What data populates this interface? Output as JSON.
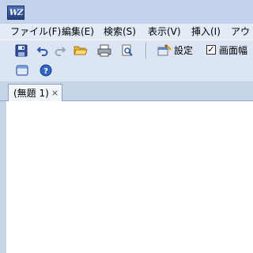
{
  "window": {
    "app_icon_text": "WZ"
  },
  "menubar": {
    "items": [
      {
        "label": "ファイル(F)"
      },
      {
        "label": "編集(E)"
      },
      {
        "label": "検索(S)"
      },
      {
        "label": "表示(V)"
      },
      {
        "label": "挿入(I)"
      },
      {
        "label": "アウト"
      }
    ]
  },
  "toolbar": {
    "settings_label": "設定",
    "screen_width_label": "画面幅",
    "screen_width_checked": true,
    "icons": [
      "save-icon",
      "undo-icon",
      "redo-icon",
      "open-folder-icon",
      "print-icon",
      "print-preview-icon",
      "settings-icon"
    ]
  },
  "toolbar2": {
    "icons": [
      "window-icon",
      "help-icon"
    ]
  },
  "tabs": [
    {
      "label": "(無題 1)",
      "close": "×"
    }
  ],
  "colors": {
    "title_bar": "#c2d2ea",
    "menu_bar": "#e3ebf6",
    "toolbar": "#dbe5f3",
    "editor": "#ffffff"
  }
}
